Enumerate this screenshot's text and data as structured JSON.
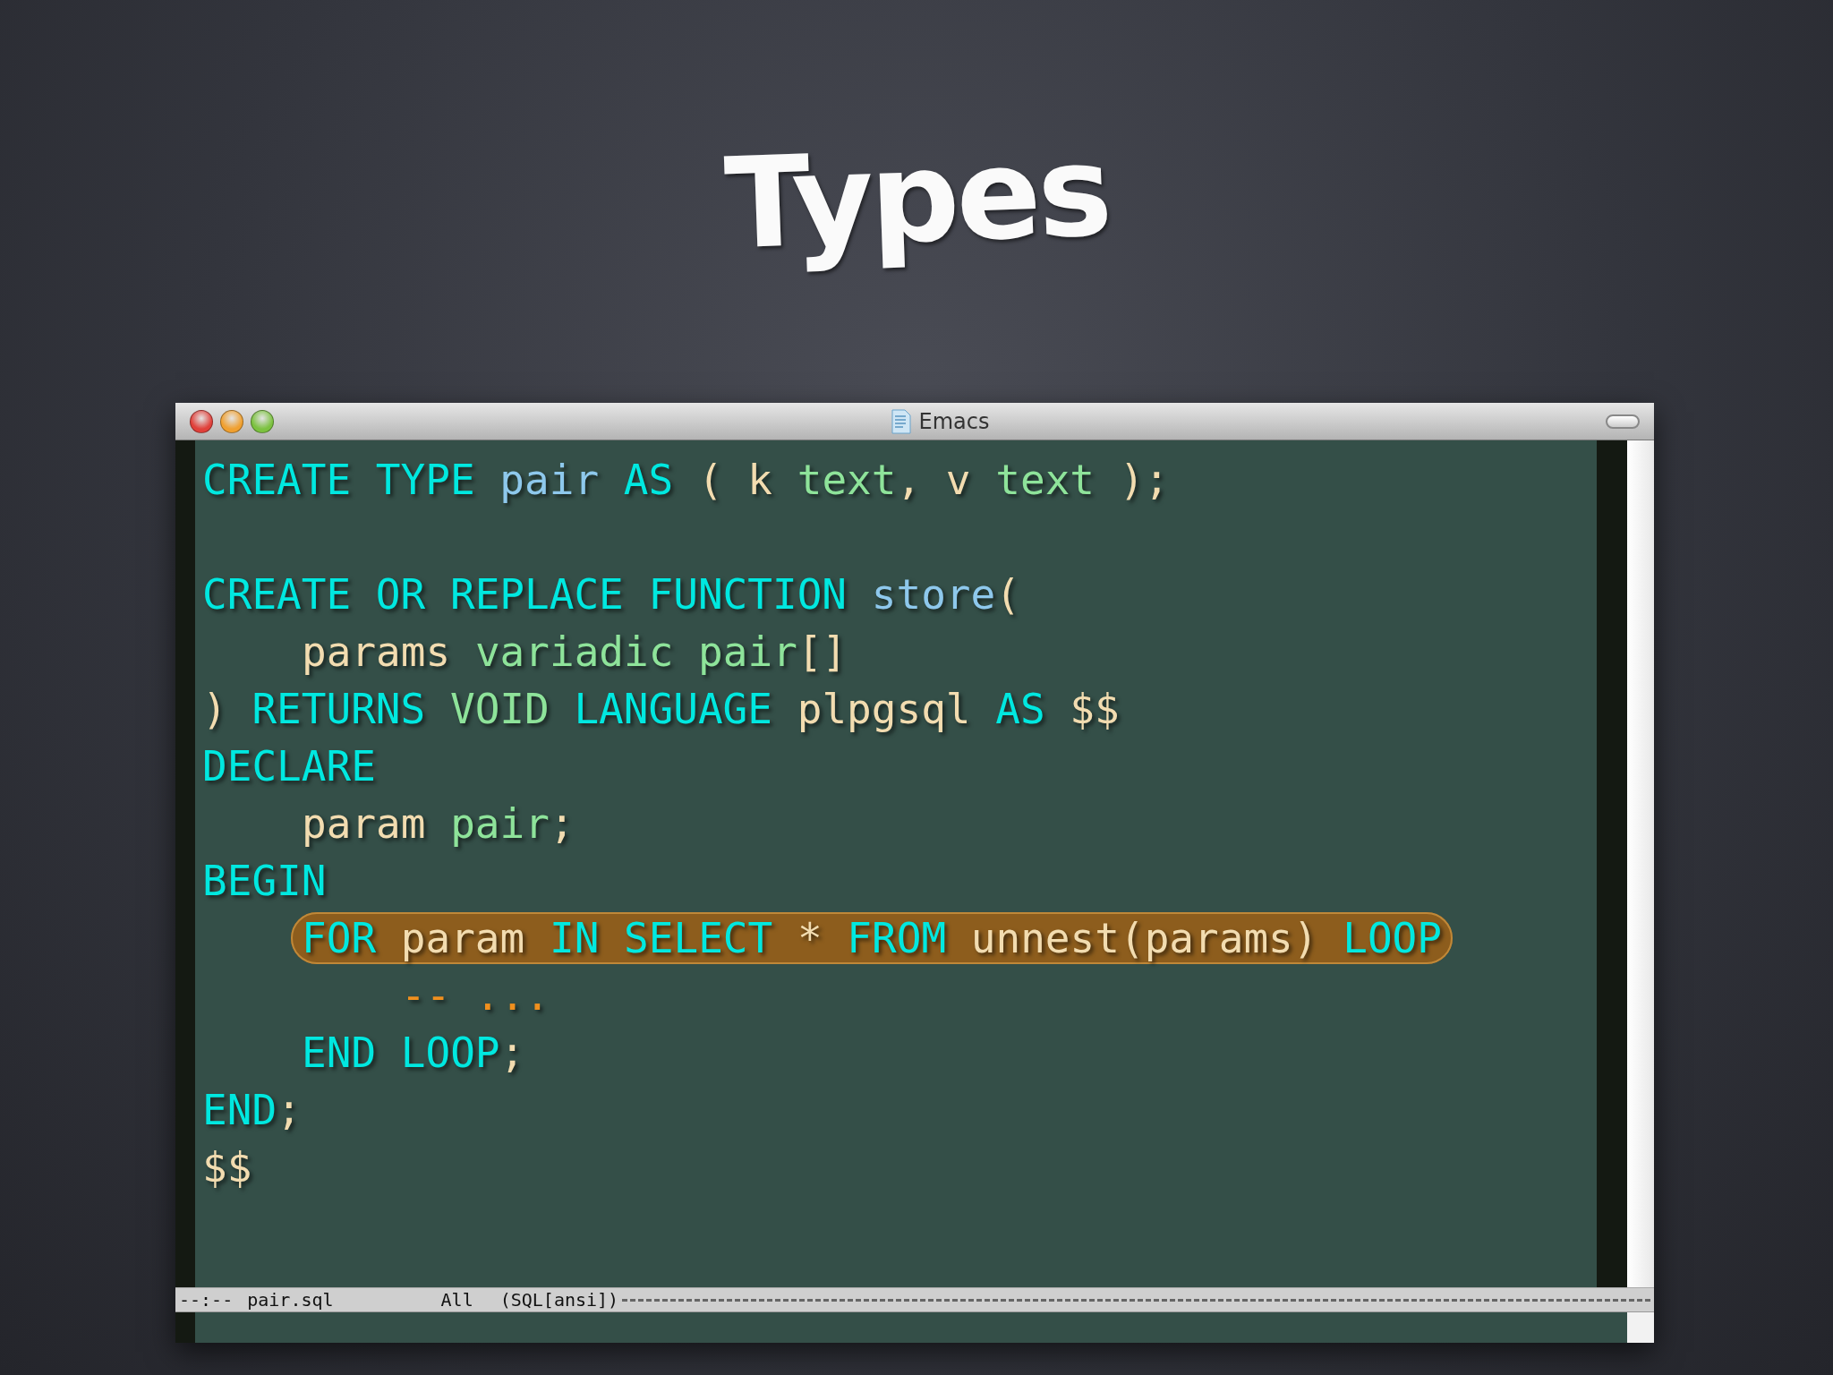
{
  "slide": {
    "title": "Types"
  },
  "window": {
    "title": "Emacs"
  },
  "code": [
    {
      "highlighted": false,
      "tokens": [
        {
          "kind": "keyword",
          "text": "CREATE TYPE "
        },
        {
          "kind": "name",
          "text": "pair"
        },
        {
          "kind": "keyword",
          "text": " AS"
        },
        {
          "kind": "plain",
          "text": " ( k "
        },
        {
          "kind": "type",
          "text": "text"
        },
        {
          "kind": "plain",
          "text": ", v "
        },
        {
          "kind": "type",
          "text": "text"
        },
        {
          "kind": "plain",
          "text": " );"
        }
      ]
    },
    {
      "kind": "blank"
    },
    {
      "highlighted": false,
      "tokens": [
        {
          "kind": "keyword",
          "text": "CREATE OR REPLACE FUNCTION "
        },
        {
          "kind": "name",
          "text": "store"
        },
        {
          "kind": "plain",
          "text": "("
        }
      ],
      "children": [
        {
          "highlighted": false,
          "tokens": [
            {
              "kind": "plain",
              "text": "params "
            },
            {
              "kind": "type",
              "text": "variadic pair"
            },
            {
              "kind": "plain",
              "text": "[]"
            }
          ]
        }
      ]
    },
    {
      "highlighted": false,
      "tokens": [
        {
          "kind": "plain",
          "text": ") "
        },
        {
          "kind": "keyword",
          "text": "RETURNS "
        },
        {
          "kind": "type",
          "text": "VOID"
        },
        {
          "kind": "keyword",
          "text": " LANGUAGE "
        },
        {
          "kind": "plain",
          "text": "plpgsql "
        },
        {
          "kind": "keyword",
          "text": "AS"
        },
        {
          "kind": "plain",
          "text": " $$"
        }
      ]
    },
    {
      "highlighted": false,
      "tokens": [
        {
          "kind": "keyword",
          "text": "DECLARE"
        }
      ],
      "children": [
        {
          "highlighted": false,
          "tokens": [
            {
              "kind": "plain",
              "text": "param "
            },
            {
              "kind": "type",
              "text": "pair"
            },
            {
              "kind": "plain",
              "text": ";"
            }
          ]
        }
      ]
    },
    {
      "highlighted": false,
      "tokens": [
        {
          "kind": "keyword",
          "text": "BEGIN"
        }
      ],
      "children": [
        {
          "highlighted": true,
          "tokens": [
            {
              "kind": "keyword",
              "text": "FOR"
            },
            {
              "kind": "plain",
              "text": " param "
            },
            {
              "kind": "keyword",
              "text": "IN SELECT"
            },
            {
              "kind": "plain",
              "text": " * "
            },
            {
              "kind": "keyword",
              "text": "FROM"
            },
            {
              "kind": "plain",
              "text": " unnest(params) "
            },
            {
              "kind": "keyword",
              "text": "LOOP"
            }
          ],
          "children": [
            {
              "highlighted": false,
              "tokens": [
                {
                  "kind": "comment",
                  "text": "-- ..."
                }
              ]
            }
          ]
        },
        {
          "highlighted": false,
          "tokens": [
            {
              "kind": "keyword",
              "text": "END LOOP"
            },
            {
              "kind": "plain",
              "text": ";"
            }
          ]
        }
      ]
    },
    {
      "highlighted": false,
      "tokens": [
        {
          "kind": "keyword",
          "text": "END"
        },
        {
          "kind": "plain",
          "text": ";"
        }
      ]
    },
    {
      "highlighted": false,
      "tokens": [
        {
          "kind": "plain",
          "text": "$$"
        }
      ]
    }
  ],
  "mode_line": {
    "status": "--:--",
    "file": "pair.sql",
    "position": "All",
    "mode": "(SQL[ansi])"
  }
}
